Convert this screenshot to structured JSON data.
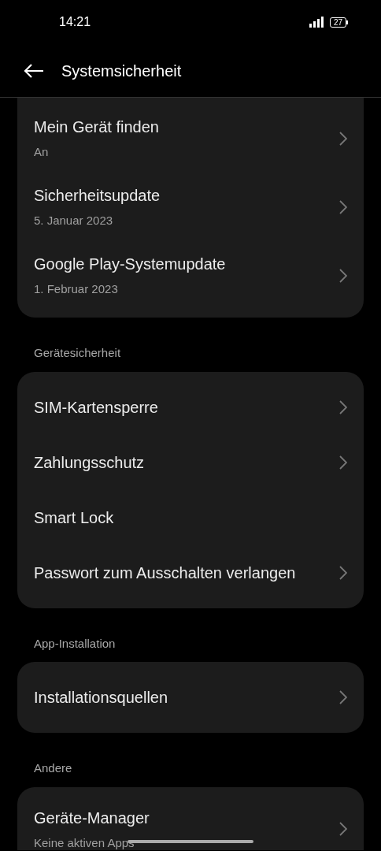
{
  "status_bar": {
    "time": "14:21",
    "battery": "27"
  },
  "header": {
    "title": "Systemsicherheit"
  },
  "sections": [
    {
      "items": [
        {
          "title": "Mein Gerät finden",
          "subtitle": "An",
          "chevron": true
        },
        {
          "title": "Sicherheitsupdate",
          "subtitle": "5. Januar 2023",
          "chevron": true
        },
        {
          "title": "Google Play-Systemupdate",
          "subtitle": "1. Februar 2023",
          "chevron": true
        }
      ]
    },
    {
      "heading": "Gerätesicherheit",
      "items": [
        {
          "title": "SIM-Kartensperre",
          "chevron": true
        },
        {
          "title": "Zahlungsschutz",
          "chevron": true
        },
        {
          "title": "Smart Lock",
          "chevron": false
        },
        {
          "title": "Passwort zum Ausschalten verlangen",
          "chevron": true
        }
      ]
    },
    {
      "heading": "App-Installation",
      "items": [
        {
          "title": "Installationsquellen",
          "chevron": true
        }
      ]
    },
    {
      "heading": "Andere",
      "items": [
        {
          "title": "Geräte-Manager",
          "subtitle": "Keine aktiven Apps",
          "chevron": true
        }
      ]
    }
  ]
}
